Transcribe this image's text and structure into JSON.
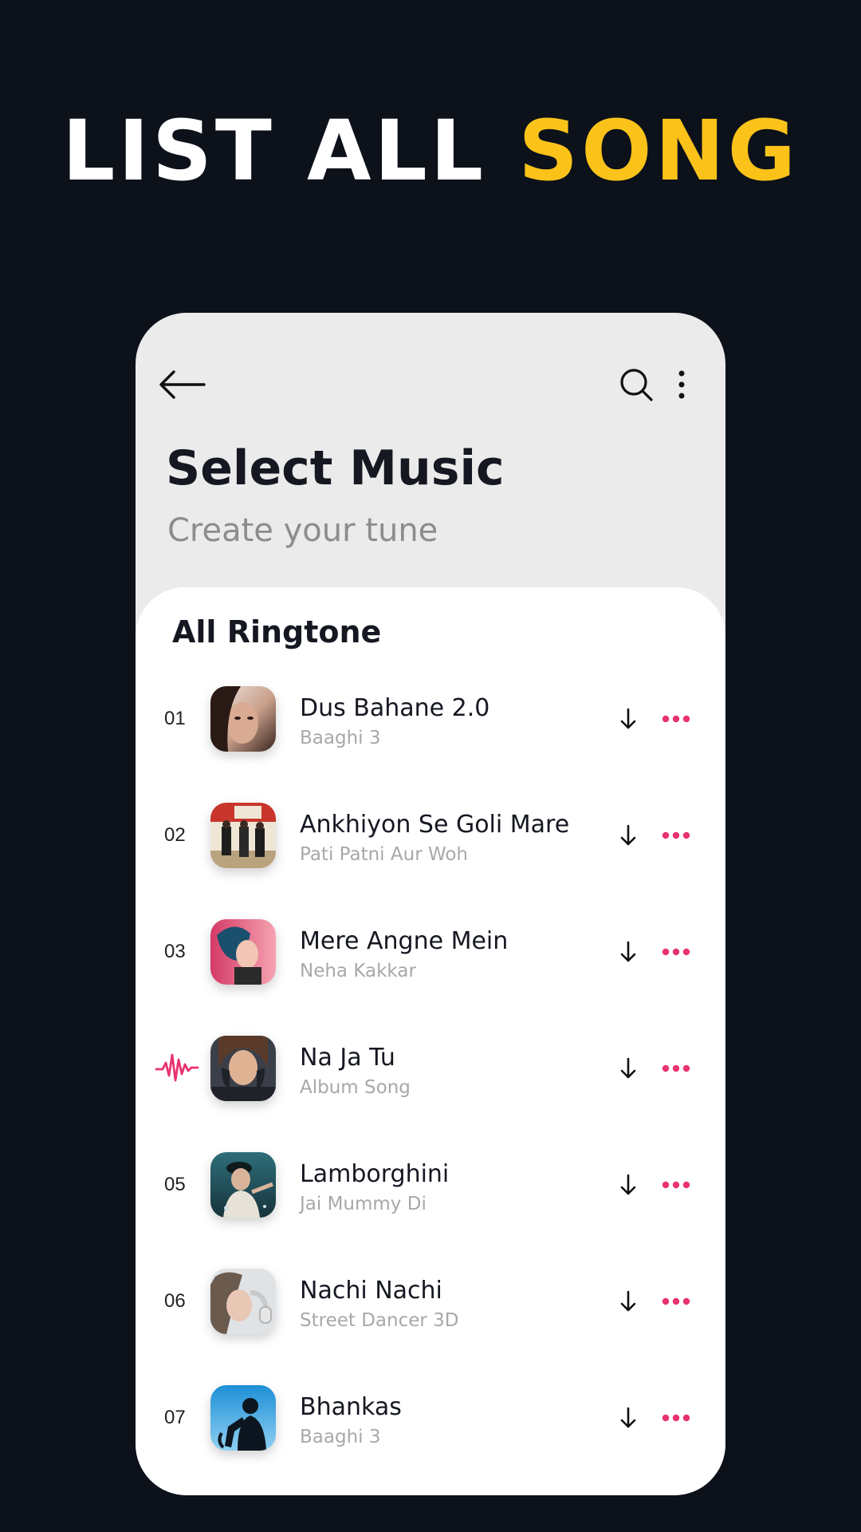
{
  "headline": {
    "part1": "LIST ALL",
    "part2": "SONG"
  },
  "colors": {
    "accent_yellow": "#fbc31a",
    "accent_pink": "#e8336f",
    "background": "#0c111a"
  },
  "header": {
    "back_icon": "arrow-left-icon",
    "search_icon": "search-icon",
    "more_icon": "more-vertical-icon",
    "title": "Select Music",
    "subtitle": "Create your tune"
  },
  "list": {
    "section_title": "All Ringtone",
    "items": [
      {
        "number": "01",
        "title": "Dus Bahane 2.0",
        "artist": "Baaghi 3",
        "playing": false
      },
      {
        "number": "02",
        "title": "Ankhiyon Se Goli Mare",
        "artist": "Pati Patni Aur Woh",
        "playing": false
      },
      {
        "number": "03",
        "title": "Mere Angne Mein",
        "artist": "Neha Kakkar",
        "playing": false
      },
      {
        "number": "",
        "title": "Na Ja Tu",
        "artist": "Album Song",
        "playing": true
      },
      {
        "number": "05",
        "title": "Lamborghini",
        "artist": "Jai Mummy Di",
        "playing": false
      },
      {
        "number": "06",
        "title": "Nachi Nachi",
        "artist": "Street Dancer 3D",
        "playing": false
      },
      {
        "number": "07",
        "title": "Bhankas",
        "artist": "Baaghi 3",
        "playing": false
      }
    ]
  }
}
